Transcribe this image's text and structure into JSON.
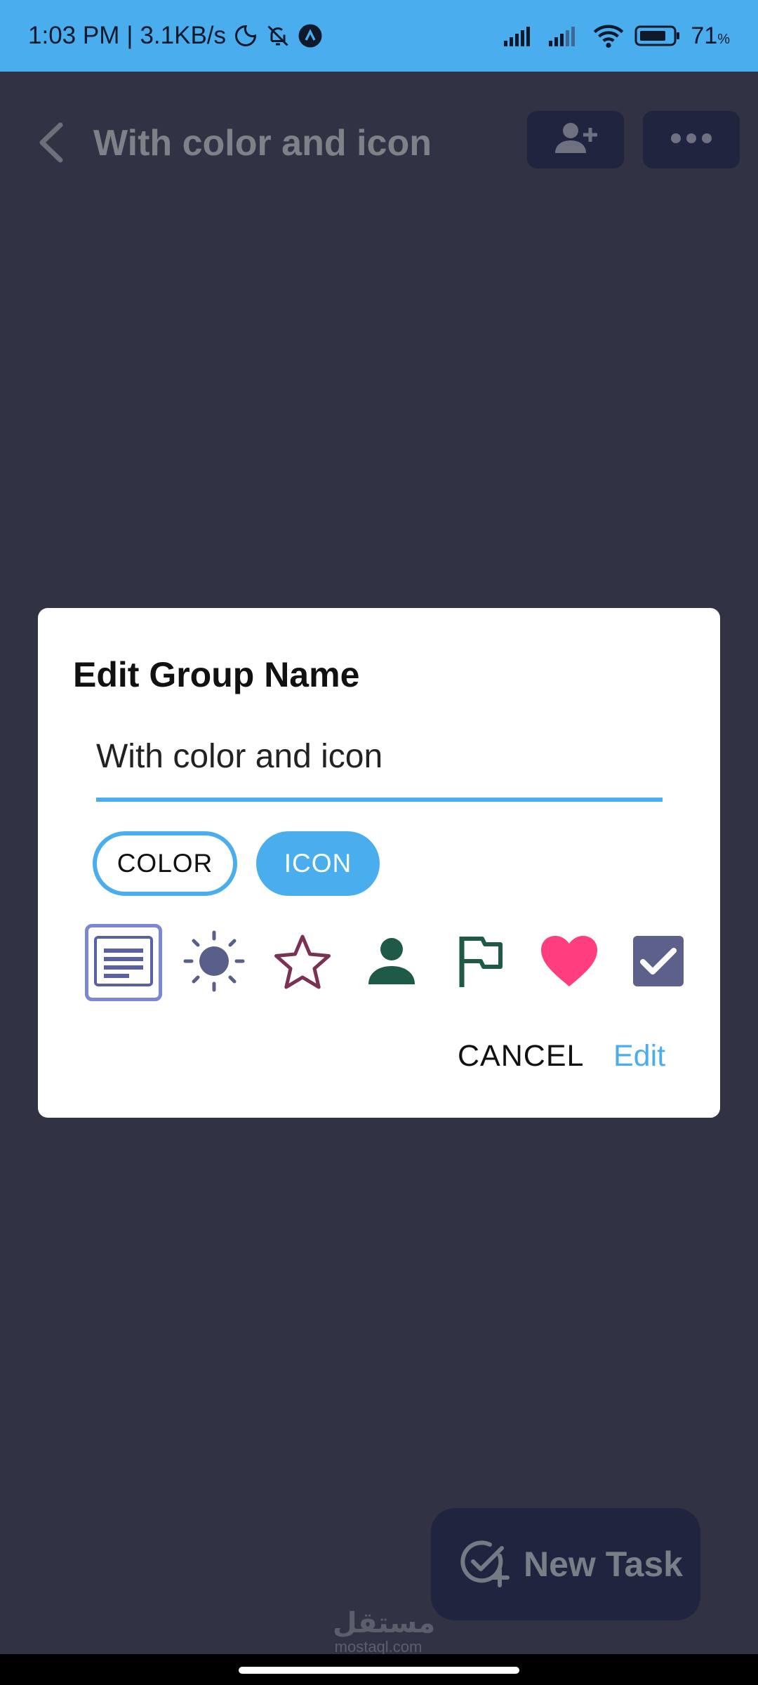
{
  "status_bar": {
    "time": "1:03 PM",
    "network_speed": "3.1KB/s",
    "battery_percent": "71",
    "battery_unit": "%",
    "icons": [
      "moon-icon",
      "bell-off-icon",
      "app-badge-icon",
      "signal-icon",
      "signal-icon",
      "wifi-icon",
      "battery-icon"
    ],
    "color": "#4aaeee"
  },
  "header": {
    "title": "With color and icon",
    "icons": [
      "back-arrow-icon",
      "add-person-icon",
      "more-dots-icon"
    ]
  },
  "dialog": {
    "title": "Edit Group Name",
    "input_value": "With color and icon",
    "toggles": [
      {
        "label": "COLOR",
        "selected": false
      },
      {
        "label": "ICON",
        "selected": true
      }
    ],
    "icon_options": [
      {
        "name": "notes-list-icon",
        "color": "#5a60a3",
        "selected": true
      },
      {
        "name": "sun-icon",
        "color": "#5a5f8a",
        "selected": false
      },
      {
        "name": "star-outline-icon",
        "color": "#7a3152",
        "selected": false
      },
      {
        "name": "person-icon",
        "color": "#1f5a48",
        "selected": false
      },
      {
        "name": "flag-icon",
        "color": "#1f5a48",
        "selected": false
      },
      {
        "name": "heart-icon",
        "color": "#ff3d7f",
        "selected": false
      },
      {
        "name": "checkbox-icon",
        "color": "#5d608a",
        "selected": false
      }
    ],
    "cancel_label": "CANCEL",
    "confirm_label": "Edit",
    "accent_color": "#4aaeee"
  },
  "fab": {
    "label": "New Task",
    "icon": "add-task-icon"
  },
  "watermark": {
    "arabic": "مستقل",
    "latin": "mostaql.com"
  }
}
